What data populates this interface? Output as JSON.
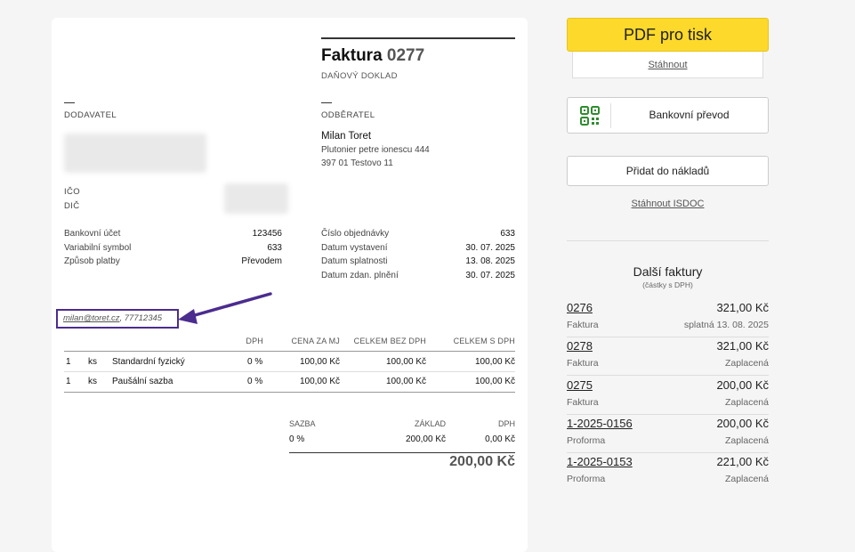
{
  "invoice": {
    "title_word": "Faktura",
    "title_number": "0277",
    "subtitle": "DAŇOVÝ DOKLAD",
    "supplier_label": "DODAVATEL",
    "customer_label": "ODBĚRATEL",
    "ico_label": "IČO",
    "dic_label": "DIČ",
    "customer": {
      "name": "Milan Toret",
      "street": "Plutonier petre ionescu 444",
      "city": "397 01 Testovo 11"
    },
    "left_details": [
      {
        "label": "Bankovní účet",
        "value": "123456"
      },
      {
        "label": "Variabilní symbol",
        "value": "633"
      },
      {
        "label": "Způsob platby",
        "value": "Převodem"
      }
    ],
    "right_details": [
      {
        "label": "Číslo objednávky",
        "value": "633"
      },
      {
        "label": "Datum vystavení",
        "value": "30. 07. 2025"
      },
      {
        "label": "Datum splatnosti",
        "value": "13. 08. 2025"
      },
      {
        "label": "Datum zdan. plnění",
        "value": "30. 07. 2025"
      }
    ],
    "contact": {
      "email": "milan@toret.cz",
      "rest": ", 77712345"
    },
    "table": {
      "headers": {
        "vat": "DPH",
        "unit_price": "CENA ZA MJ",
        "total_no_vat": "CELKEM BEZ DPH",
        "total_vat": "CELKEM S DPH"
      },
      "rows": [
        {
          "qty": "1",
          "unit": "ks",
          "name": "Standardní fyzický",
          "vat": "0 %",
          "unit_price": "100,00 Kč",
          "total_no_vat": "100,00 Kč",
          "total_vat": "100,00 Kč"
        },
        {
          "qty": "1",
          "unit": "ks",
          "name": "Paušální sazba",
          "vat": "0 %",
          "unit_price": "100,00 Kč",
          "total_no_vat": "100,00 Kč",
          "total_vat": "100,00 Kč"
        }
      ]
    },
    "summary": {
      "headers": {
        "rate": "SAZBA",
        "base": "ZÁKLAD",
        "vat": "DPH"
      },
      "row": {
        "rate": "0 %",
        "base": "200,00 Kč",
        "vat": "0,00 Kč"
      },
      "total": "200,00 Kč"
    }
  },
  "sidebar": {
    "pdf_button": "PDF pro tisk",
    "download_link": "Stáhnout",
    "bank_transfer_button": "Bankovní převod",
    "add_costs_button": "Přidat do nákladů",
    "isdoc_link": "Stáhnout ISDOC",
    "more_title": "Další faktury",
    "more_subtitle": "(částky s DPH)",
    "invoices": [
      {
        "number": "0276",
        "amount": "321,00 Kč",
        "type": "Faktura",
        "status": "splatná 13. 08. 2025"
      },
      {
        "number": "0278",
        "amount": "321,00 Kč",
        "type": "Faktura",
        "status": "Zaplacená"
      },
      {
        "number": "0275",
        "amount": "200,00 Kč",
        "type": "Faktura",
        "status": "Zaplacená"
      },
      {
        "number": "1-2025-0156",
        "amount": "200,00 Kč",
        "type": "Proforma",
        "status": "Zaplacená"
      },
      {
        "number": "1-2025-0153",
        "amount": "221,00 Kč",
        "type": "Proforma",
        "status": "Zaplacená"
      }
    ]
  },
  "colors": {
    "pdf_button": "#fcd92b",
    "annotation": "#4b2c8f",
    "qr_icon": "#2e8b2e"
  }
}
